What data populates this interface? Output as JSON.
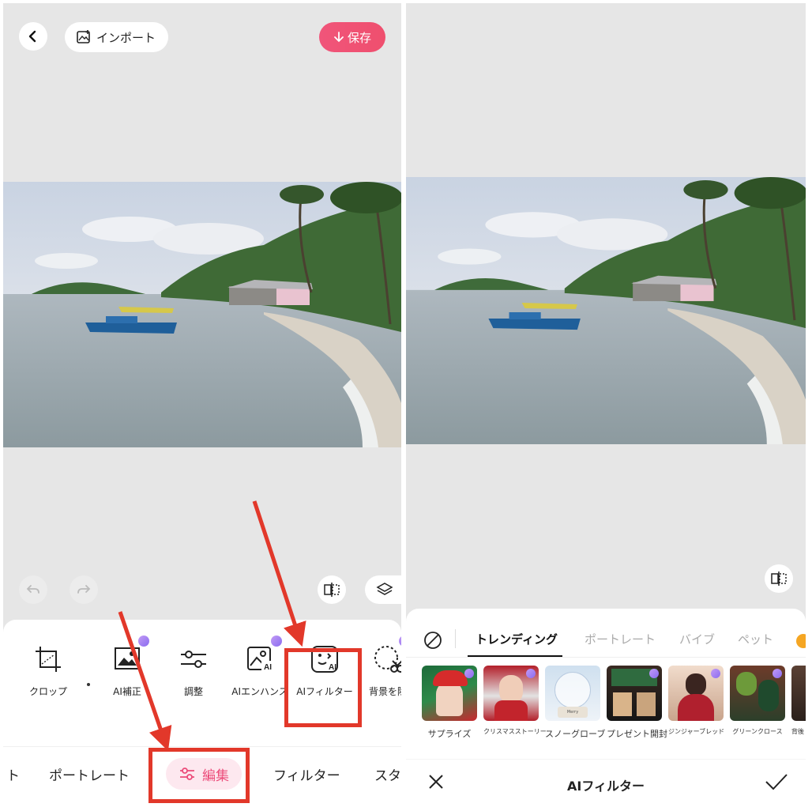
{
  "left": {
    "header": {
      "import_label": "インポート",
      "save_label": "保存"
    },
    "tools": [
      {
        "label": "クロップ",
        "icon": "crop-icon"
      },
      {
        "label": "AI補正",
        "icon": "ai-enhance-image-icon"
      },
      {
        "label": "調整",
        "icon": "adjust-sliders-icon"
      },
      {
        "label": "AIエンハンス",
        "icon": "ai-enhance-icon"
      },
      {
        "label": "AIフィルター",
        "icon": "ai-filter-face-icon"
      },
      {
        "label": "背景を除",
        "icon": "background-remove-icon"
      }
    ],
    "tabs": [
      {
        "label": "ト"
      },
      {
        "label": "ポートレート"
      },
      {
        "label": "編集"
      },
      {
        "label": "フィルター"
      },
      {
        "label": "スタ"
      }
    ]
  },
  "right": {
    "categories": [
      {
        "label": "トレンディング"
      },
      {
        "label": "ポートレート"
      },
      {
        "label": "バイブ"
      },
      {
        "label": "ペット"
      }
    ],
    "thumbnails": [
      {
        "label": "サプライズ"
      },
      {
        "label": "クリスマスストーリー"
      },
      {
        "label": "スノーグローブ"
      },
      {
        "label": "プレゼント開封"
      },
      {
        "label": "ジンジャーブレッド"
      },
      {
        "label": "グリーンクロース"
      },
      {
        "label": "背後"
      }
    ],
    "snowglobe_caption": "Merry Christmas",
    "bottom_title": "AIフィルター"
  },
  "colors": {
    "accent_pink": "#ef4f6e",
    "annotation_red": "#e2382a",
    "sheet_bg": "#ffffff",
    "canvas_bg": "#e6e6e6"
  }
}
